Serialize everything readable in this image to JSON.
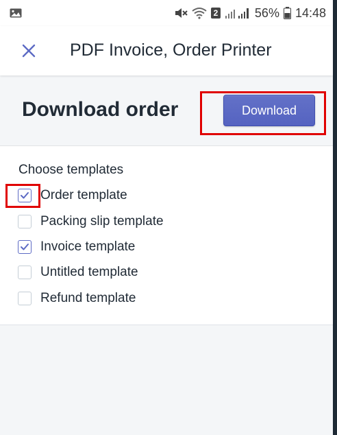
{
  "status_bar": {
    "battery_percent": "56%",
    "time": "14:48",
    "sim_badge": "2",
    "icons": [
      "image-icon",
      "mute-icon",
      "wifi-icon",
      "signal-icon",
      "battery-icon"
    ]
  },
  "header": {
    "title": "PDF Invoice, Order Printer",
    "close_icon": "close-icon"
  },
  "order": {
    "title": "Download order",
    "download_label": "Download"
  },
  "templates": {
    "label": "Choose templates",
    "items": [
      {
        "label": "Order template",
        "checked": true
      },
      {
        "label": "Packing slip template",
        "checked": false
      },
      {
        "label": "Invoice template",
        "checked": true
      },
      {
        "label": "Untitled template",
        "checked": false
      },
      {
        "label": "Refund template",
        "checked": false
      }
    ]
  },
  "colors": {
    "accent": "#5c6ac4",
    "highlight": "#e00000",
    "text": "#212b36"
  }
}
